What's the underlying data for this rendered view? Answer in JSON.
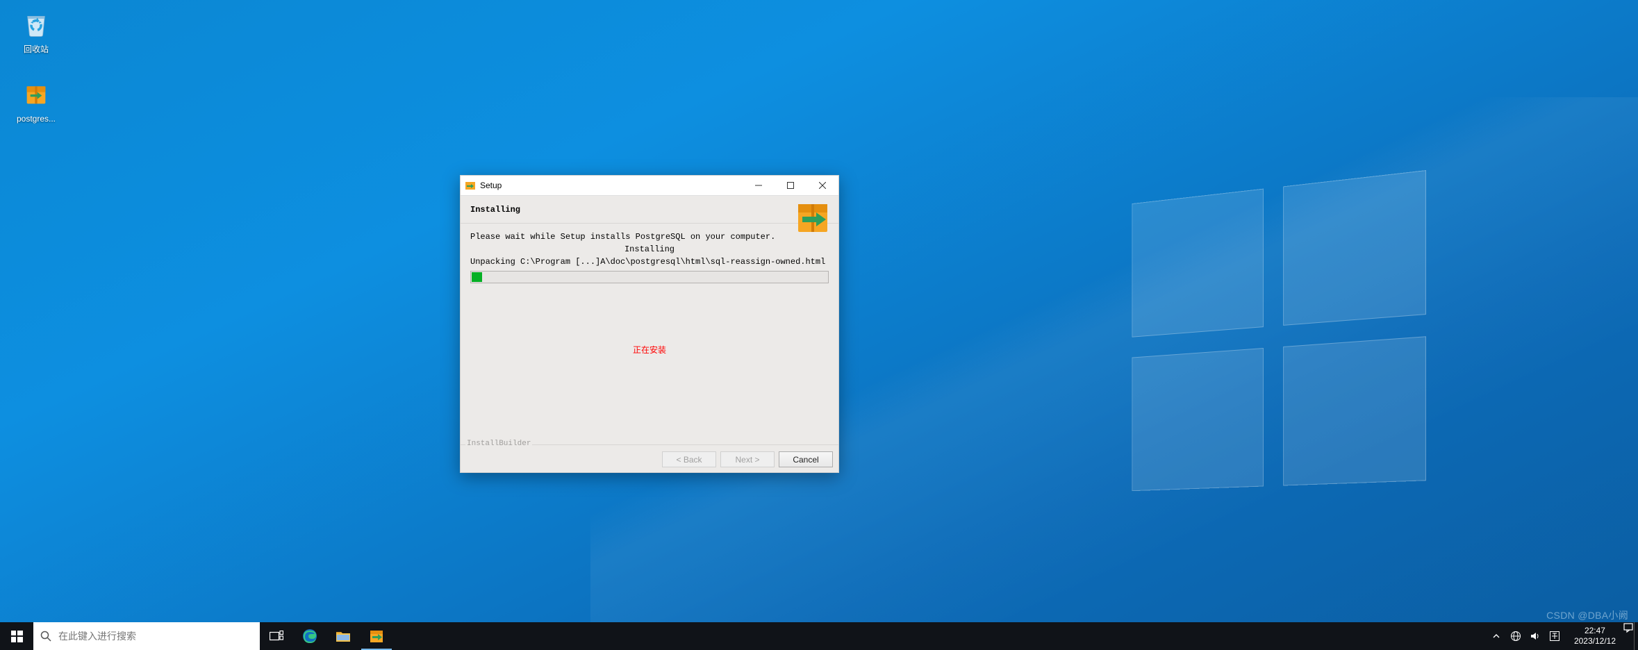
{
  "desktop": {
    "icons": [
      {
        "name": "回收站"
      },
      {
        "name": "postgres..."
      }
    ]
  },
  "installer": {
    "title": "Setup",
    "header": "Installing",
    "waitText": "Please wait while Setup installs PostgreSQL on your computer.",
    "statusLabel": "Installing",
    "unpackText": "Unpacking C:\\Program [...]A\\doc\\postgresql\\html\\sql-reassign-owned.html",
    "progressPercent": 3,
    "annotation": "正在安装",
    "brand": "InstallBuilder",
    "buttons": {
      "back": "< Back",
      "next": "Next >",
      "cancel": "Cancel"
    }
  },
  "taskbar": {
    "searchPlaceholder": "在此键入进行搜索",
    "clock": {
      "time": "22:47",
      "date": "2023/12/12"
    }
  },
  "watermark": "CSDN @DBA小阙"
}
